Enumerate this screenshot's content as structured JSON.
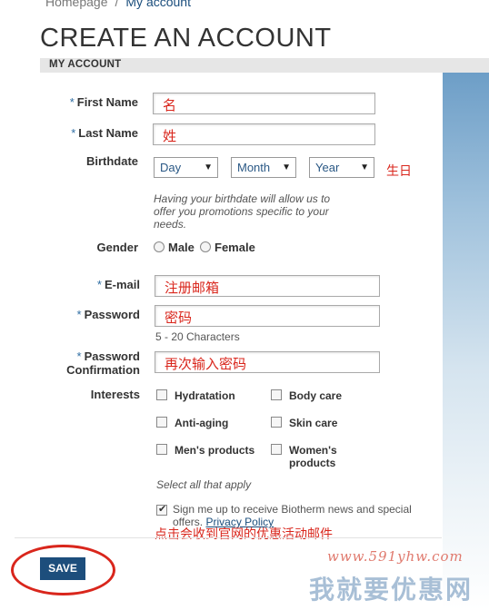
{
  "breadcrumb": {
    "home": "Homepage",
    "separator": "/",
    "current": "My account"
  },
  "page_title": "CREATE AN ACCOUNT",
  "section_title": "MY ACCOUNT",
  "required_mark": "*",
  "first_name": {
    "label": "First Name",
    "value": "名"
  },
  "last_name": {
    "label": "Last Name",
    "value": "姓"
  },
  "birthdate": {
    "label": "Birthdate",
    "day": "Day",
    "month": "Month",
    "year": "Year",
    "annotation": "生日",
    "hint": "Having your birthdate will allow us to offer you promotions specific to your needs."
  },
  "gender": {
    "label": "Gender",
    "male": "Male",
    "female": "Female"
  },
  "email": {
    "label": "E-mail",
    "value": "注册邮箱"
  },
  "password": {
    "label": "Password",
    "value": "密码",
    "hint": "5 - 20 Characters"
  },
  "password_confirm": {
    "label_line1": "Password",
    "label_line2": "Confirmation",
    "value": "再次输入密码"
  },
  "interests": {
    "label": "Interests",
    "hydratation": "Hydratation",
    "body_care": "Body care",
    "anti_aging": "Anti-aging",
    "skin_care": "Skin care",
    "mens_products": "Men's products",
    "womens_line1": "Women's",
    "womens_line2": "products",
    "hint": "Select all that apply"
  },
  "newsletter": {
    "text": "Sign me up to receive Biotherm news and special",
    "text2": "offers.",
    "privacy_link": "Privacy Policy",
    "annotation": "点击会收到官网的优惠活动邮件"
  },
  "save_label": "SAVE",
  "watermark": {
    "url": "www.591yhw.com",
    "text": "我就要优惠网"
  },
  "colors": {
    "accent": "#1d4e7c",
    "annotation": "#d9261c"
  }
}
